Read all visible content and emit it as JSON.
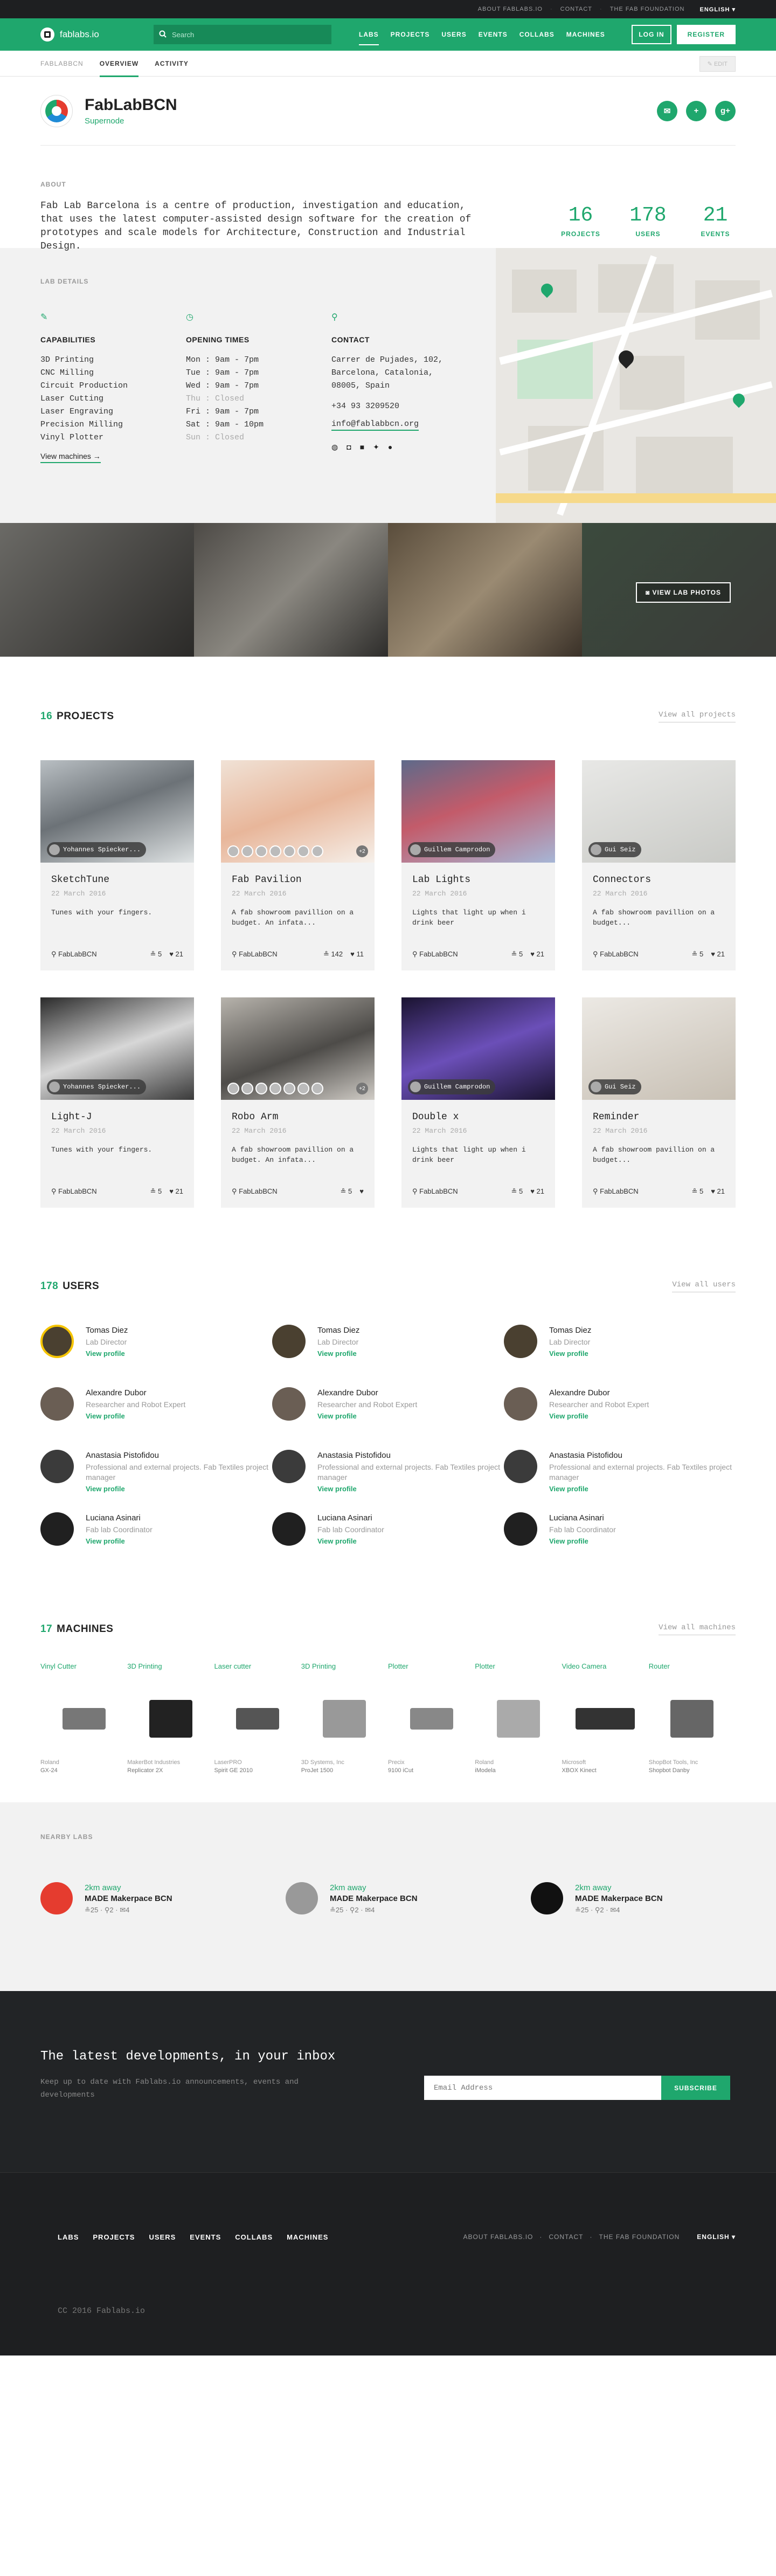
{
  "topbar": {
    "about": "ABOUT FABLABS.IO",
    "sep": "·",
    "contact": "CONTACT",
    "foundation": "THE FAB FOUNDATION",
    "language": "ENGLISH"
  },
  "header": {
    "logo_text": "fablabs.io",
    "search_placeholder": "Search",
    "nav": [
      "LABS",
      "PROJECTS",
      "USERS",
      "EVENTS",
      "COLLABS",
      "MACHINES"
    ],
    "login": "LOG IN",
    "register": "REGISTER"
  },
  "subnav": {
    "crumb": "FABLABBCN",
    "tabs": [
      "OVERVIEW",
      "ACTIVITY"
    ],
    "edit": "EDIT"
  },
  "lab": {
    "name": "FabLabBCN",
    "kind": "Supernode"
  },
  "about": {
    "label": "ABOUT",
    "text": "Fab Lab Barcelona is a centre of production, investigation and education, that uses the latest computer-assisted design software for the creation of prototypes and scale models for Architecture, Construction and Industrial Design.",
    "stats": [
      {
        "n": "16",
        "l": "PROJECTS"
      },
      {
        "n": "178",
        "l": "USERS"
      },
      {
        "n": "21",
        "l": "EVENTS"
      }
    ]
  },
  "details": {
    "label": "LAB DETAILS",
    "capabilities": {
      "title": "CAPABILITIES",
      "items": [
        "3D Printing",
        "CNC Milling",
        "Circuit Production",
        "Laser Cutting",
        "Laser Engraving",
        "Precision Milling",
        "Vinyl Plotter"
      ],
      "more": "View machines →"
    },
    "hours": {
      "title": "OPENING TIMES",
      "items": [
        "Mon : 9am - 7pm",
        "Tue : 9am - 7pm",
        "Wed : 9am - 7pm",
        "Thu : Closed",
        "Fri : 9am - 7pm",
        "Sat : 9am - 10pm",
        "Sun : Closed"
      ]
    },
    "contact": {
      "title": "CONTACT",
      "address": [
        "Carrer de Pujades, 102,",
        "Barcelona, Catalonia,",
        "08005, Spain"
      ],
      "phone": "+34 93 3209520",
      "email": "info@fablabbcn.org"
    }
  },
  "photos": {
    "button": "VIEW LAB PHOTOS"
  },
  "projects": {
    "count": "16",
    "title": "PROJECTS",
    "view_all": "View all projects",
    "lab": "FabLabBCN",
    "items": [
      {
        "title": "SketchTune",
        "date": "22 March 2016",
        "desc": "Tunes with your fingers.",
        "author": "Yohannes Spiecker...",
        "members": "5",
        "likes": "21",
        "plus": ""
      },
      {
        "title": "Fab Pavilion",
        "date": "22 March 2016",
        "desc": "A fab showroom pavillion on a budget. An infata...",
        "author": "",
        "members": "142",
        "likes": "11",
        "plus": "+2"
      },
      {
        "title": "Lab Lights",
        "date": "22 March 2016",
        "desc": "Lights that light up when i drink beer",
        "author": "Guillem Camprodon",
        "members": "5",
        "likes": "21",
        "plus": ""
      },
      {
        "title": "Connectors",
        "date": "22 March 2016",
        "desc": "A fab showroom pavillion on a budget...",
        "author": "Gui Seiz",
        "members": "5",
        "likes": "21",
        "plus": ""
      },
      {
        "title": "Light-J",
        "date": "22 March 2016",
        "desc": "Tunes with your fingers.",
        "author": "Yohannes Spiecker...",
        "members": "5",
        "likes": "21",
        "plus": ""
      },
      {
        "title": "Robo Arm",
        "date": "22 March 2016",
        "desc": "A fab showroom pavillion on a budget. An infata...",
        "author": "",
        "members": "5",
        "likes": "",
        "plus": "+2"
      },
      {
        "title": "Double x",
        "date": "22 March 2016",
        "desc": "Lights that light up when i drink beer",
        "author": "Guillem Camprodon",
        "members": "5",
        "likes": "21",
        "plus": ""
      },
      {
        "title": "Reminder",
        "date": "22 March 2016",
        "desc": "A fab showroom pavillion on a budget...",
        "author": "Gui Seiz",
        "members": "5",
        "likes": "21",
        "plus": ""
      }
    ]
  },
  "users": {
    "count": "178",
    "title": "USERS",
    "view_all": "View all users",
    "view_profile": "View profile",
    "items": [
      {
        "name": "Tomas Diez",
        "role": "Lab Director"
      },
      {
        "name": "Tomas Diez",
        "role": "Lab Director"
      },
      {
        "name": "Tomas Diez",
        "role": "Lab Director"
      },
      {
        "name": "Alexandre Dubor",
        "role": "Researcher and Robot Expert"
      },
      {
        "name": "Alexandre Dubor",
        "role": "Researcher and Robot Expert"
      },
      {
        "name": "Alexandre Dubor",
        "role": "Researcher and Robot Expert"
      },
      {
        "name": "Anastasia Pistofidou",
        "role": "Professional and external projects. Fab Textiles project manager"
      },
      {
        "name": "Anastasia Pistofidou",
        "role": "Professional and external projects. Fab Textiles project manager"
      },
      {
        "name": "Anastasia Pistofidou",
        "role": "Professional and external projects. Fab Textiles project manager"
      },
      {
        "name": "Luciana Asinari",
        "role": "Fab lab Coordinator"
      },
      {
        "name": "Luciana Asinari",
        "role": "Fab lab Coordinator"
      },
      {
        "name": "Luciana Asinari",
        "role": "Fab lab Coordinator"
      }
    ]
  },
  "machines": {
    "count": "17",
    "title": "MACHINES",
    "view_all": "View all machines",
    "items": [
      {
        "cat": "Vinyl Cutter",
        "brand": "Roland",
        "model": "GX-24"
      },
      {
        "cat": "3D Printing",
        "brand": "MakerBot Industries",
        "model": "Replicator 2X"
      },
      {
        "cat": "Laser cutter",
        "brand": "LaserPRO",
        "model": "Spirit GE 2010"
      },
      {
        "cat": "3D Printing",
        "brand": "3D Systems, Inc",
        "model": "ProJet 1500"
      },
      {
        "cat": "Plotter",
        "brand": "Precix",
        "model": "9100 iCut"
      },
      {
        "cat": "Plotter",
        "brand": "Roland",
        "model": "iModela"
      },
      {
        "cat": "Video Camera",
        "brand": "Microsoft",
        "model": "XBOX Kinect"
      },
      {
        "cat": "Router",
        "brand": "ShopBot Tools, Inc",
        "model": "Shopbot Danby"
      }
    ]
  },
  "nearby": {
    "label": "NEARBY LABS",
    "items": [
      {
        "km": "2km away",
        "name": "MADE Makerpace BCN",
        "stats": "≗25  ·  ⚲2  ·  ✉4"
      },
      {
        "km": "2km away",
        "name": "MADE Makerpace BCN",
        "stats": "≗25  ·  ⚲2  ·  ✉4"
      },
      {
        "km": "2km away",
        "name": "MADE Makerpace BCN",
        "stats": "≗25  ·  ⚲2  ·  ✉4"
      }
    ]
  },
  "newsletter": {
    "title": "The latest developments, in your inbox",
    "text": "Keep up to date with Fablabs.io announcements, events and developments",
    "placeholder": "Email Address",
    "button": "SUBSCRIBE"
  },
  "footer": {
    "nav": [
      "LABS",
      "PROJECTS",
      "USERS",
      "EVENTS",
      "COLLABS",
      "MACHINES"
    ],
    "about": "ABOUT FABLABS.IO",
    "contact": "CONTACT",
    "foundation": "THE FAB FOUNDATION",
    "language": "ENGLISH",
    "copy": "CC 2016 Fablabs.io"
  }
}
